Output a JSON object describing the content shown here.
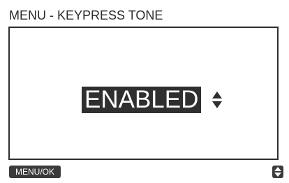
{
  "screen": {
    "title": "MENU - KEYPRESS TONE"
  },
  "setting": {
    "value": "ENABLED",
    "adjust_icon": "up-down-arrows-icon"
  },
  "footer": {
    "menu_ok_label": "MENU/OK",
    "nav_icon": "up-down-arrows-icon"
  },
  "colors": {
    "text": "#2a2a2a",
    "highlight_bg": "#2f2f2f",
    "highlight_text": "#ffffff",
    "button_bg": "#3b3b3b",
    "border": "#2e2e2e"
  }
}
